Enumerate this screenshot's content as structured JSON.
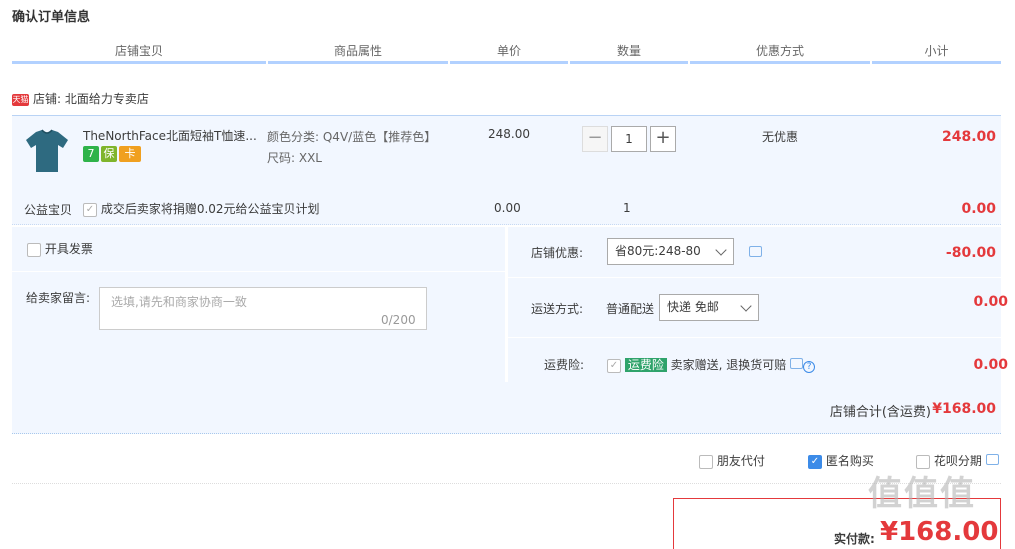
{
  "page": {
    "title": "确认订单信息"
  },
  "columns": [
    "店铺宝贝",
    "商品属性",
    "单价",
    "数量",
    "优惠方式",
    "小计"
  ],
  "shop": {
    "badge": "天猫",
    "label": "店铺: 北面给力专卖店"
  },
  "item": {
    "name": "TheNorthFace北面短袖T恤速...",
    "attr_color": "颜色分类: Q4V/蓝色【推荐色】",
    "attr_size": "尺码: XXL",
    "price": "248.00",
    "qty": "1",
    "promo": "无优惠",
    "subtotal": "248.00",
    "badges": [
      "7",
      "保",
      "卡"
    ]
  },
  "charity": {
    "label": "公益宝贝",
    "text": "成交后卖家将捐赠0.02元给公益宝贝计划",
    "price": "0.00",
    "qty": "1",
    "subtotal": "0.00"
  },
  "invoice": {
    "label": "开具发票"
  },
  "note": {
    "label": "给卖家留言:",
    "placeholder": "选填,请先和商家协商一致",
    "counter": "0/200"
  },
  "shop_discount": {
    "label": "店铺优惠:",
    "value": "省80元:248-80",
    "amount": "-80.00"
  },
  "shipping": {
    "label": "运送方式:",
    "type": "普通配送",
    "option": "快递 免邮",
    "amount": "0.00"
  },
  "insurance": {
    "label": "运费险:",
    "badge": "运费险",
    "text": "卖家赠送, 退换货可赔",
    "amount": "0.00"
  },
  "total": {
    "label": "店铺合计(含运费)",
    "value": "¥168.00"
  },
  "options": {
    "friend": "朋友代付",
    "anonymous": "匿名购买",
    "huabei": "花呗分期"
  },
  "pay": {
    "label": "实付款:",
    "value": "¥168.00"
  },
  "watermark": "值值值",
  "colors": {
    "accent": "#e4393c",
    "blue": "#3c8be8",
    "panel": "#f2f7ff"
  }
}
